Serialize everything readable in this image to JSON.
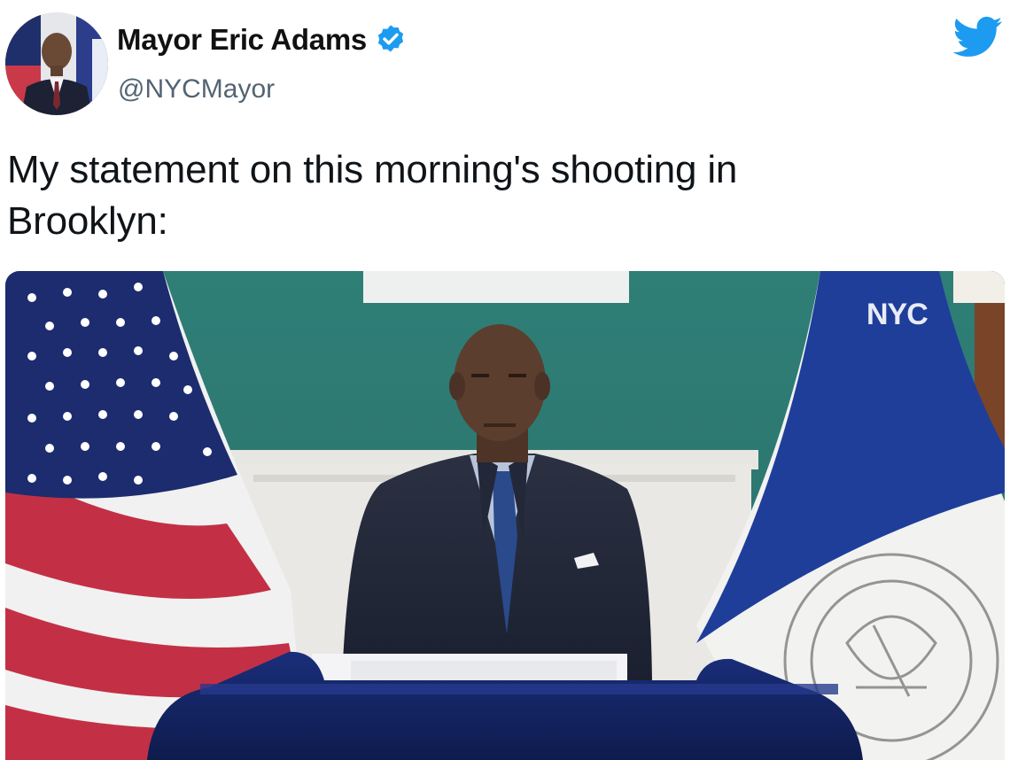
{
  "author": {
    "name": "Mayor Eric Adams",
    "handle": "@NYCMayor",
    "verified": true
  },
  "tweet": {
    "text_line1": "My statement on this morning's shooting in",
    "text_line2": "Brooklyn:"
  },
  "media": {
    "flag_text": "NYC"
  },
  "icons": {
    "verified": "verified-badge-icon",
    "brand": "twitter-bird-icon"
  },
  "colors": {
    "verified_blue": "#1d9bf0",
    "twitter_blue": "#1d9bf0",
    "handle_gray": "#536471"
  }
}
